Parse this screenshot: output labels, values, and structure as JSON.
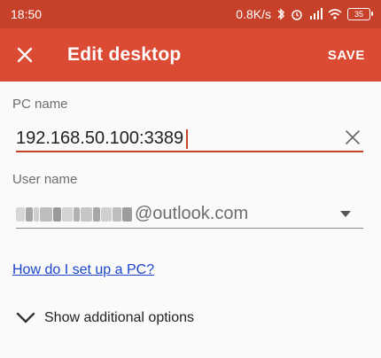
{
  "status_bar": {
    "time": "18:50",
    "network_speed": "0.8K/s",
    "battery_level": "35",
    "icons": [
      "bluetooth-icon",
      "alarm-icon",
      "signal-icon",
      "wifi-icon",
      "battery-icon"
    ]
  },
  "app_bar": {
    "title": "Edit desktop",
    "save_label": "SAVE",
    "close_icon": "close-icon"
  },
  "form": {
    "pc_name": {
      "label": "PC name",
      "value": "192.168.50.100:3389"
    },
    "user_name": {
      "label": "User name",
      "value_domain": "@outlook.com"
    }
  },
  "help_link": "How do I set up a PC?",
  "additional_options_label": "Show additional options",
  "colors": {
    "status_bar": "#c7402a",
    "app_bar": "#db4a33",
    "accent": "#c7402a",
    "link": "#1a44cc"
  }
}
